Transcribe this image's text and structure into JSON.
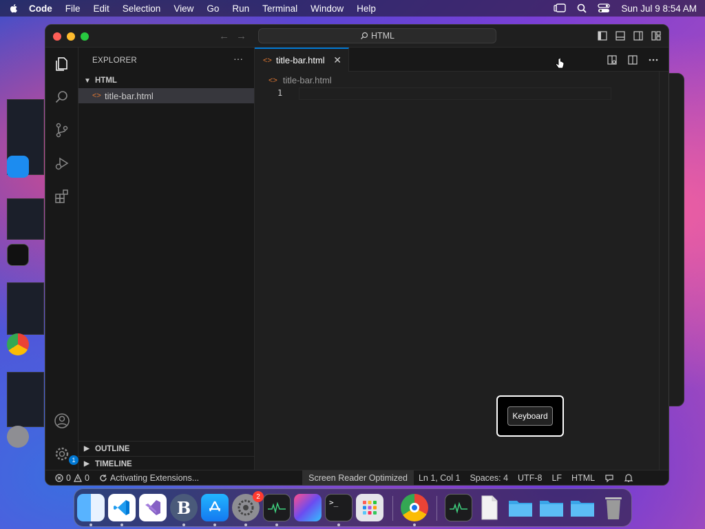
{
  "menubar": {
    "app_name": "Code",
    "items": [
      "File",
      "Edit",
      "Selection",
      "View",
      "Go",
      "Run",
      "Terminal",
      "Window",
      "Help"
    ],
    "datetime": "Sun Jul 9  8:54 AM"
  },
  "window": {
    "command_center": "HTML"
  },
  "sidebar": {
    "title": "EXPLORER",
    "folder": "HTML",
    "file": "title-bar.html",
    "outline": "OUTLINE",
    "timeline": "TIMELINE"
  },
  "activitybar": {
    "settings_badge": "1"
  },
  "editor": {
    "tab_label": "title-bar.html",
    "breadcrumb": "title-bar.html",
    "line_number": "1"
  },
  "overlay": {
    "keyboard_label": "Keyboard"
  },
  "statusbar": {
    "errors": "0",
    "warnings": "0",
    "activity": "Activating Extensions...",
    "screen_reader": "Screen Reader Optimized",
    "position": "Ln 1, Col 1",
    "spaces": "Spaces: 4",
    "encoding": "UTF-8",
    "eol": "LF",
    "language": "HTML"
  },
  "dock": {
    "settings_badge": "2"
  },
  "colors": {
    "accent": "#0078d4",
    "html_icon": "#e37933",
    "close_red": "#ff5f57",
    "min_yellow": "#febc2e",
    "max_green": "#28c840"
  }
}
